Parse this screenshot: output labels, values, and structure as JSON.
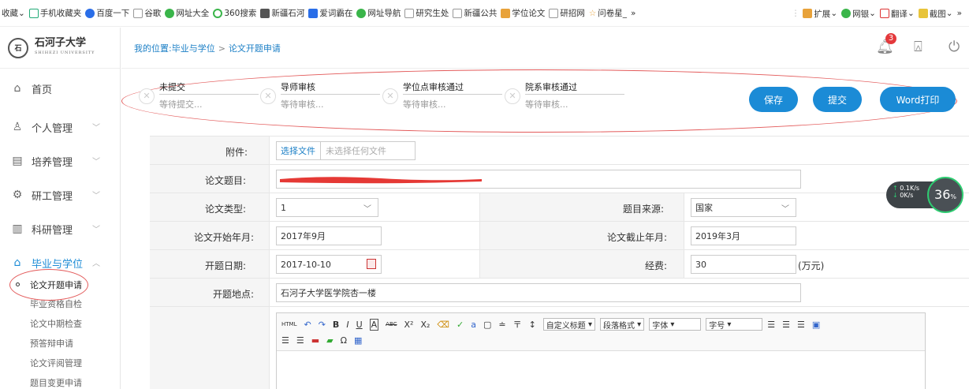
{
  "bookmarks": {
    "items": [
      {
        "label": "收藏",
        "icon": "star-icon"
      },
      {
        "label": "手机收藏夹",
        "icon": "phone-icon"
      },
      {
        "label": "百度一下",
        "icon": "paw-icon"
      },
      {
        "label": "谷歌",
        "icon": "page-icon"
      },
      {
        "label": "网址大全",
        "icon": "globe-icon"
      },
      {
        "label": "360搜索",
        "icon": "circle-icon"
      },
      {
        "label": "新疆石河",
        "icon": "image-icon"
      },
      {
        "label": "爱词霸在",
        "icon": "image-icon"
      },
      {
        "label": "网址导航",
        "icon": "globe-icon"
      },
      {
        "label": "研究生处",
        "icon": "page-icon"
      },
      {
        "label": "新疆公共",
        "icon": "page-icon"
      },
      {
        "label": "学位论文",
        "icon": "zhi-icon"
      },
      {
        "label": "研招网",
        "icon": "page-icon"
      },
      {
        "label": "问卷星_",
        "icon": "star-icon"
      }
    ],
    "more": "»",
    "right": [
      {
        "label": "扩展",
        "icon": "grid-icon"
      },
      {
        "label": "网银",
        "icon": "bank-icon"
      },
      {
        "label": "翻译",
        "icon": "translate-icon"
      },
      {
        "label": "截图",
        "icon": "scissors-icon"
      }
    ],
    "right_more": "»"
  },
  "sidebar": {
    "logo_text": "石河子大学",
    "logo_sub": "SHIHEZI UNIVERSITY",
    "items": [
      {
        "label": "首页",
        "icon": "home-icon"
      },
      {
        "label": "个人管理",
        "icon": "user-icon"
      },
      {
        "label": "培养管理",
        "icon": "book-icon"
      },
      {
        "label": "研工管理",
        "icon": "gear-icon"
      },
      {
        "label": "科研管理",
        "icon": "chart-icon"
      },
      {
        "label": "毕业与学位",
        "icon": "graduation-cap-icon"
      }
    ],
    "sub_items": [
      "论文开题申请",
      "毕业资格自检",
      "论文中期检查",
      "预答辩申请",
      "论文评阅管理",
      "题目变更申请"
    ]
  },
  "header": {
    "breadcrumb_prefix": "我的位置:",
    "breadcrumb_parent": "毕业与学位",
    "breadcrumb_sep": ">",
    "breadcrumb_current": "论文开题申请",
    "badge_count": "3"
  },
  "steps": [
    {
      "title": "未提交",
      "desc": "等待提交..."
    },
    {
      "title": "导师审核",
      "desc": "等待审核..."
    },
    {
      "title": "学位点审核通过",
      "desc": "等待审核..."
    },
    {
      "title": "院系审核通过",
      "desc": "等待审核..."
    }
  ],
  "actions": {
    "save": "保存",
    "submit": "提交",
    "print": "Word打印"
  },
  "form": {
    "attachment_label": "附件:",
    "attachment_button": "选择文件",
    "attachment_none": "未选择任何文件",
    "title_label": "论文题目:",
    "type_label": "论文类型:",
    "type_value": "1",
    "source_label": "题目来源:",
    "source_value": "国家",
    "start_label": "论文开始年月:",
    "start_value": "2017年9月",
    "end_label": "论文截止年月:",
    "end_value": "2019年3月",
    "date_label": "开题日期:",
    "date_value": "2017-10-10",
    "fund_label": "经费:",
    "fund_value": "30",
    "fund_unit": "(万元)",
    "place_label": "开题地点:",
    "place_value": "石河子大学医学院杏一楼"
  },
  "editor": {
    "toolbar_row1": [
      "HTML",
      "↶",
      "↷",
      "B",
      "I",
      "U",
      "A",
      "ABC",
      "X²",
      "X₂",
      "⌫",
      "✓",
      "a",
      "▢",
      "≐",
      "〒",
      "↕"
    ],
    "custom_title": "自定义标题",
    "paragraph": "段落格式",
    "font": "字体",
    "font_size": "字号"
  },
  "net_widget": {
    "up": "0.1K/s",
    "down": "0K/s",
    "percent": "36",
    "percent_unit": "%"
  }
}
